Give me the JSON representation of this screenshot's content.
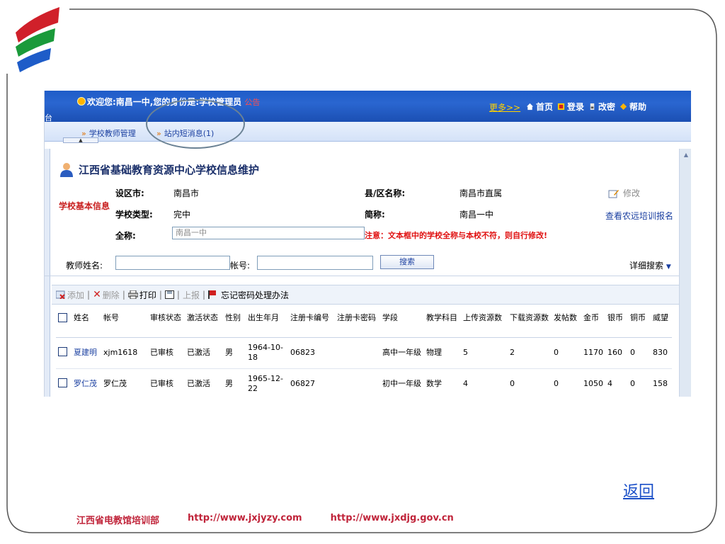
{
  "topbar": {
    "welcome": "欢迎您:南昌一中,您的身份是:学校管理员",
    "notice": "公告",
    "left_fragment": "台",
    "more": "更多>>",
    "nav": [
      {
        "label": "首页",
        "icon": "home-icon"
      },
      {
        "label": "登录",
        "icon": "login-icon"
      },
      {
        "label": "改密",
        "icon": "lock-icon"
      },
      {
        "label": "帮助",
        "icon": "help-icon"
      }
    ]
  },
  "subnav": {
    "items": [
      "学校教师管理",
      "站内短消息(1)"
    ],
    "handle": "▲"
  },
  "panel": {
    "title": "江西省基础教育资源中心学校信息维护"
  },
  "info": {
    "category": "学校基本信息",
    "district_label": "设区市:",
    "district_value": "南昌市",
    "county_label": "县/区名称:",
    "county_value": "南昌市直属",
    "type_label": "学校类型:",
    "type_value": "完中",
    "short_label": "简称:",
    "short_value": "南昌一中",
    "fullname_label": "全称:",
    "fullname_value": "南昌一中",
    "warning": "注意：文本框中的学校全称与本校不符，则自行修改!",
    "edit_label": "修改",
    "remote_link": "查看农远培训报名"
  },
  "search": {
    "name_label": "教师姓名:",
    "account_label": "帐号:",
    "button": "搜索",
    "advanced": "详细搜索"
  },
  "toolbar": {
    "add": "添加",
    "delete": "删除",
    "print": "打印",
    "save": "",
    "report": "上报",
    "forgot": "忘记密码处理办法"
  },
  "table": {
    "headers": [
      "姓名",
      "帐号",
      "审核状态",
      "激活状态",
      "性别",
      "出生年月",
      "注册卡编号",
      "注册卡密码",
      "学段",
      "教学科目",
      "上传资源数",
      "下载资源数",
      "发帖数",
      "金币",
      "银币",
      "铜币",
      "威望"
    ],
    "rows": [
      [
        "夏建明",
        "xjm1618",
        "已审核",
        "已激活",
        "男",
        "1964-10-18",
        "06823",
        "",
        "高中一年级",
        "物理",
        "5",
        "2",
        "0",
        "1170",
        "160",
        "0",
        "830"
      ],
      [
        "罗仁茂",
        "罗仁茂",
        "已审核",
        "已激活",
        "男",
        "1965-12-22",
        "06827",
        "",
        "初中一年级",
        "数学",
        "4",
        "0",
        "0",
        "1050",
        "4",
        "0",
        "158"
      ]
    ]
  },
  "slide": {
    "back": "返回",
    "footer": [
      "江西省电教馆培训部",
      "http://www.jxjyzy.com",
      "http://www.jxdjg.gov.cn"
    ]
  }
}
